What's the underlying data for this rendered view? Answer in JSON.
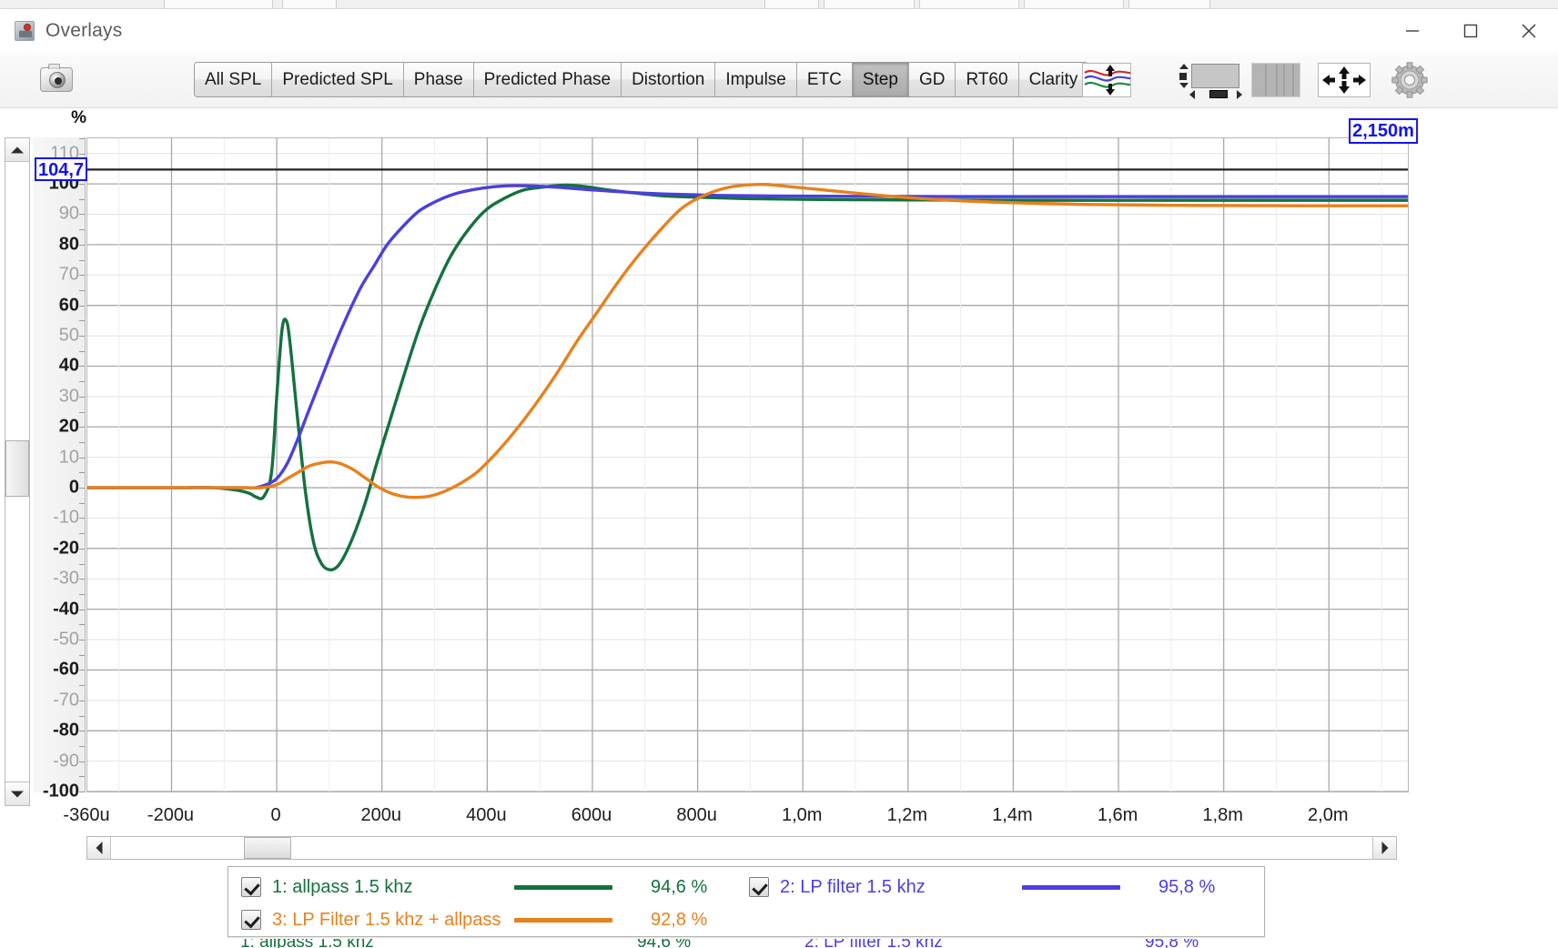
{
  "window": {
    "title": "Overlays",
    "icon": "overlays-app-icon",
    "buttons": {
      "minimize": "minimize-icon",
      "maximize": "maximize-icon",
      "close": "close-icon"
    }
  },
  "toolbar": {
    "camera_icon": "camera-icon",
    "tabs": [
      {
        "label": "All SPL",
        "active": false
      },
      {
        "label": "Predicted SPL",
        "active": false
      },
      {
        "label": "Phase",
        "active": false
      },
      {
        "label": "Predicted Phase",
        "active": false
      },
      {
        "label": "Distortion",
        "active": false
      },
      {
        "label": "Impulse",
        "active": false
      },
      {
        "label": "ETC",
        "active": false
      },
      {
        "label": "Step",
        "active": true
      },
      {
        "label": "GD",
        "active": false
      },
      {
        "label": "RT60",
        "active": false
      },
      {
        "label": "Clarity",
        "active": false
      }
    ],
    "right_icons": [
      {
        "name": "waves-limits-icon"
      },
      {
        "name": "pan-scroll-icon"
      },
      {
        "name": "vertical-bars-icon"
      },
      {
        "name": "fit-to-screen-icon"
      },
      {
        "name": "gear-icon"
      }
    ]
  },
  "cursors": {
    "y_value": "104,7",
    "x_value": "2,150m"
  },
  "chart_data": {
    "type": "line",
    "title": "Step",
    "xlabel": "",
    "ylabel": "%",
    "unit_label": "%",
    "xlim": [
      -360,
      2150
    ],
    "ylim": [
      -100,
      115
    ],
    "grid": true,
    "legend_position": "bottom",
    "y_unit_suffix": "",
    "x_tick_labels": [
      "-360u",
      "-200u",
      "0",
      "200u",
      "400u",
      "600u",
      "800u",
      "1,0m",
      "1,2m",
      "1,4m",
      "1,6m",
      "1,8m",
      "2,0m"
    ],
    "x_tick_values": [
      -360,
      -200,
      0,
      200,
      400,
      600,
      800,
      1000,
      1200,
      1400,
      1600,
      1800,
      2000
    ],
    "y_tick_labels": [
      "110",
      "100",
      "90",
      "80",
      "70",
      "60",
      "50",
      "40",
      "30",
      "20",
      "10",
      "0",
      "-10",
      "-20",
      "-30",
      "-40",
      "-50",
      "-60",
      "-70",
      "-80",
      "-90",
      "-100"
    ],
    "y_tick_values": [
      110,
      100,
      90,
      80,
      70,
      60,
      50,
      40,
      30,
      20,
      10,
      0,
      -10,
      -20,
      -30,
      -40,
      -50,
      -60,
      -70,
      -80,
      -90,
      -100
    ],
    "y_cursor_line": 104.7,
    "series": [
      {
        "name": "1: allpass 1.5 khz",
        "color": "#14713f",
        "value": "94,6 %",
        "checked": true,
        "points": [
          [
            -360,
            0
          ],
          [
            -200,
            0
          ],
          [
            -120,
            0
          ],
          [
            -70,
            -1
          ],
          [
            -50,
            -2
          ],
          [
            -40,
            -3
          ],
          [
            -25,
            -3
          ],
          [
            -10,
            5
          ],
          [
            0,
            30
          ],
          [
            10,
            52
          ],
          [
            18,
            55
          ],
          [
            25,
            48
          ],
          [
            40,
            22
          ],
          [
            55,
            -2
          ],
          [
            70,
            -18
          ],
          [
            85,
            -25
          ],
          [
            100,
            -27
          ],
          [
            115,
            -26
          ],
          [
            130,
            -22
          ],
          [
            150,
            -14
          ],
          [
            170,
            -4
          ],
          [
            190,
            8
          ],
          [
            215,
            22
          ],
          [
            240,
            36
          ],
          [
            270,
            52
          ],
          [
            300,
            65
          ],
          [
            330,
            76
          ],
          [
            360,
            84
          ],
          [
            395,
            91
          ],
          [
            430,
            95
          ],
          [
            470,
            98
          ],
          [
            510,
            99
          ],
          [
            550,
            99.6
          ],
          [
            590,
            99
          ],
          [
            630,
            98
          ],
          [
            680,
            97
          ],
          [
            740,
            96
          ],
          [
            800,
            95.6
          ],
          [
            880,
            95.2
          ],
          [
            960,
            95
          ],
          [
            1060,
            94.8
          ],
          [
            1200,
            94.7
          ],
          [
            1400,
            94.6
          ],
          [
            1700,
            94.6
          ],
          [
            2000,
            94.6
          ],
          [
            2150,
            94.6
          ]
        ]
      },
      {
        "name": "2: LP filter 1.5 khz",
        "color": "#4b3fe0",
        "value": "95,8 %",
        "checked": true,
        "points": [
          [
            -360,
            0
          ],
          [
            -200,
            0
          ],
          [
            -120,
            0
          ],
          [
            -60,
            0
          ],
          [
            -40,
            0
          ],
          [
            -20,
            1
          ],
          [
            0,
            3
          ],
          [
            20,
            8
          ],
          [
            40,
            16
          ],
          [
            60,
            25
          ],
          [
            85,
            36
          ],
          [
            110,
            47
          ],
          [
            135,
            57
          ],
          [
            160,
            66
          ],
          [
            185,
            73
          ],
          [
            210,
            80
          ],
          [
            240,
            86
          ],
          [
            270,
            91
          ],
          [
            300,
            94
          ],
          [
            335,
            96.5
          ],
          [
            370,
            98
          ],
          [
            410,
            99
          ],
          [
            450,
            99.4
          ],
          [
            490,
            99.3
          ],
          [
            540,
            98.8
          ],
          [
            600,
            98
          ],
          [
            670,
            97.2
          ],
          [
            750,
            96.6
          ],
          [
            840,
            96.2
          ],
          [
            950,
            96
          ],
          [
            1100,
            95.9
          ],
          [
            1300,
            95.8
          ],
          [
            1600,
            95.8
          ],
          [
            2000,
            95.8
          ],
          [
            2150,
            95.8
          ]
        ]
      },
      {
        "name": "3: LP Filter 1.5 khz + allpass",
        "color": "#e8811c",
        "value": "92,8 %",
        "checked": true,
        "points": [
          [
            -360,
            0
          ],
          [
            -200,
            0
          ],
          [
            -120,
            0
          ],
          [
            -60,
            0
          ],
          [
            -30,
            0
          ],
          [
            0,
            1
          ],
          [
            20,
            3
          ],
          [
            40,
            5
          ],
          [
            60,
            7
          ],
          [
            80,
            8
          ],
          [
            100,
            8.5
          ],
          [
            120,
            8
          ],
          [
            145,
            6
          ],
          [
            170,
            3
          ],
          [
            195,
            0
          ],
          [
            220,
            -2
          ],
          [
            245,
            -3
          ],
          [
            265,
            -3.2
          ],
          [
            290,
            -2.8
          ],
          [
            315,
            -1.5
          ],
          [
            345,
            1
          ],
          [
            380,
            5
          ],
          [
            415,
            11
          ],
          [
            450,
            18
          ],
          [
            490,
            27
          ],
          [
            530,
            37
          ],
          [
            570,
            48
          ],
          [
            610,
            58
          ],
          [
            650,
            68
          ],
          [
            690,
            77
          ],
          [
            730,
            85
          ],
          [
            770,
            92
          ],
          [
            810,
            96
          ],
          [
            850,
            98.5
          ],
          [
            890,
            99.6
          ],
          [
            930,
            99.8
          ],
          [
            980,
            99
          ],
          [
            1040,
            98
          ],
          [
            1110,
            96.8
          ],
          [
            1190,
            95.6
          ],
          [
            1280,
            94.6
          ],
          [
            1400,
            93.8
          ],
          [
            1550,
            93.2
          ],
          [
            1750,
            92.9
          ],
          [
            1950,
            92.8
          ],
          [
            2150,
            92.8
          ]
        ]
      }
    ]
  },
  "legend": {
    "entries": [
      {
        "label": "1: allpass 1.5 khz",
        "value": "94,6 %",
        "color": "#14713f",
        "checked": true
      },
      {
        "label": "2: LP filter 1.5 khz",
        "value": "95,8 %",
        "color": "#4b3fe0",
        "checked": true
      },
      {
        "label": "3: LP Filter 1.5 khz + allpass",
        "value": "92,8 %",
        "color": "#e8811c",
        "checked": true
      }
    ]
  },
  "scrollbars": {
    "vertical": {
      "up_arrow": "scroll-up-arrow",
      "down_arrow": "scroll-down-arrow"
    },
    "horizontal": {
      "left_arrow": "scroll-left-arrow",
      "right_arrow": "scroll-right-arrow"
    }
  }
}
